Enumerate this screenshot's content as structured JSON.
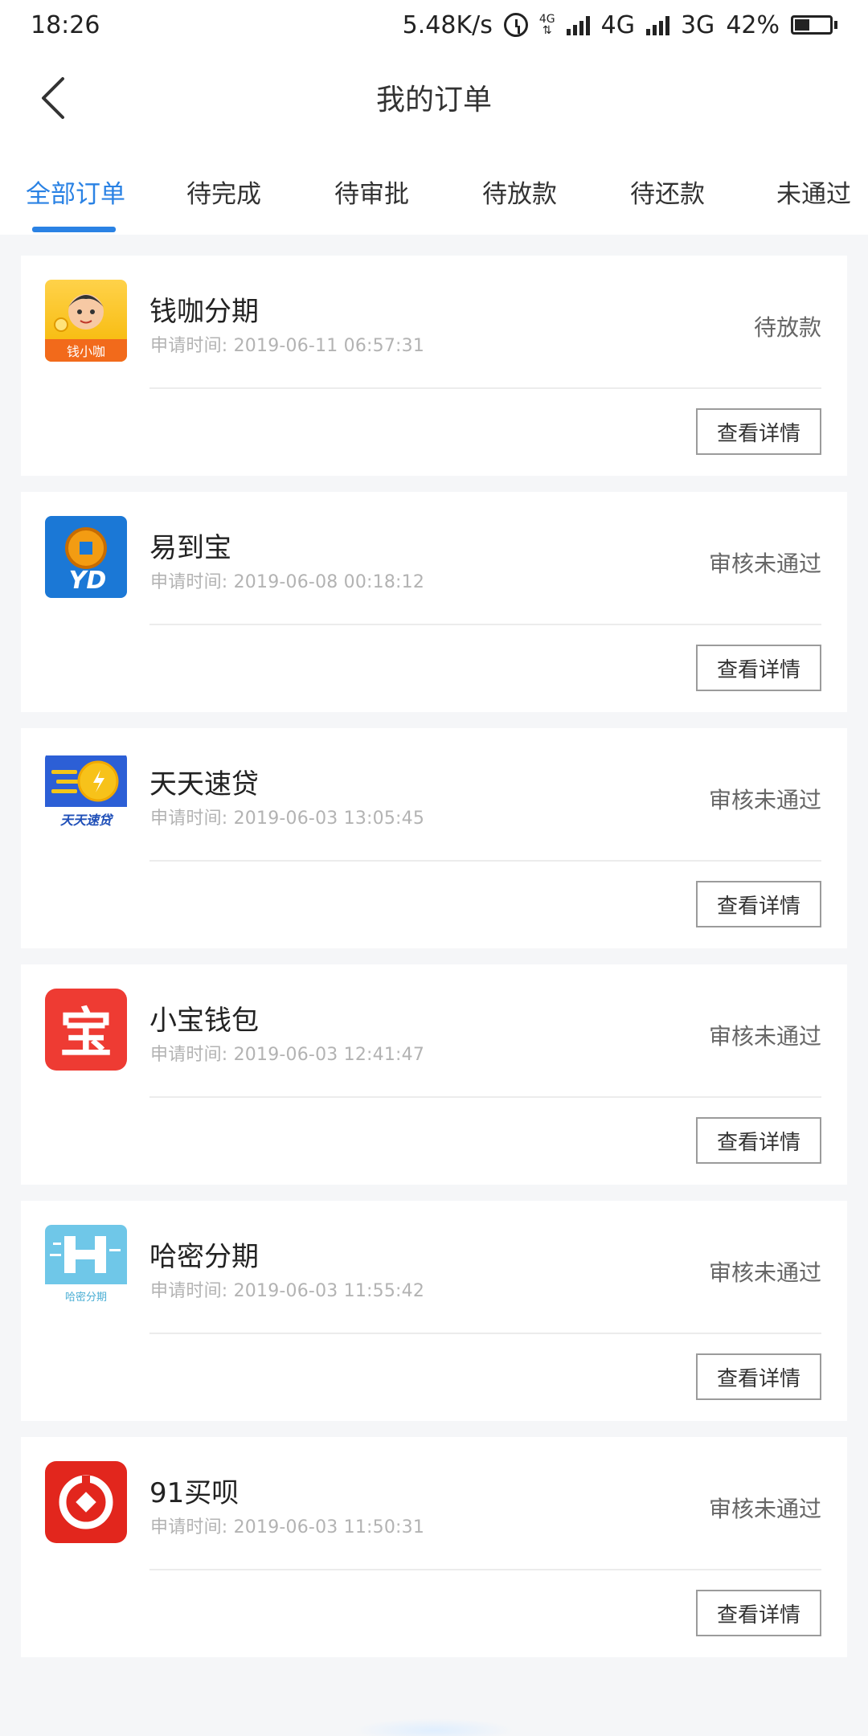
{
  "status_bar": {
    "time": "18:26",
    "speed": "5.48K/s",
    "net1": "4G",
    "net1_small": "4G",
    "net2": "3G",
    "battery": "42%",
    "battery_level": 0.42
  },
  "header": {
    "title": "我的订单"
  },
  "tabs": [
    {
      "label": "全部订单",
      "active": true
    },
    {
      "label": "待完成"
    },
    {
      "label": "待审批"
    },
    {
      "label": "待放款"
    },
    {
      "label": "待还款"
    },
    {
      "label": "未通过"
    }
  ],
  "orders": [
    {
      "name": "钱咖分期",
      "time": "申请时间: 2019-06-11 06:57:31",
      "status": "待放款",
      "button": "查看详情",
      "logo_text": "钱小咖",
      "logo_icon": "cartoon-mascot-icon"
    },
    {
      "name": "易到宝",
      "time": "申请时间: 2019-06-08 00:18:12",
      "status": "审核未通过",
      "button": "查看详情",
      "logo_text": "YD",
      "logo_icon": "coin-icon"
    },
    {
      "name": "天天速贷",
      "time": "申请时间: 2019-06-03 13:05:45",
      "status": "审核未通过",
      "button": "查看详情",
      "logo_text": "天天速贷",
      "logo_icon": "flying-coin-icon"
    },
    {
      "name": "小宝钱包",
      "time": "申请时间: 2019-06-03 12:41:47",
      "status": "审核未通过",
      "button": "查看详情",
      "logo_text": "宝",
      "logo_icon": "bao-character-icon"
    },
    {
      "name": "哈密分期",
      "time": "申请时间: 2019-06-03 11:55:42",
      "status": "审核未通过",
      "button": "查看详情",
      "logo_text": "哈密分期",
      "logo_icon": "letter-h-icon"
    },
    {
      "name": "91买呗",
      "time": "申请时间: 2019-06-03 11:50:31",
      "status": "审核未通过",
      "button": "查看详情",
      "logo_text": "",
      "logo_icon": "circle-diamond-icon"
    }
  ]
}
